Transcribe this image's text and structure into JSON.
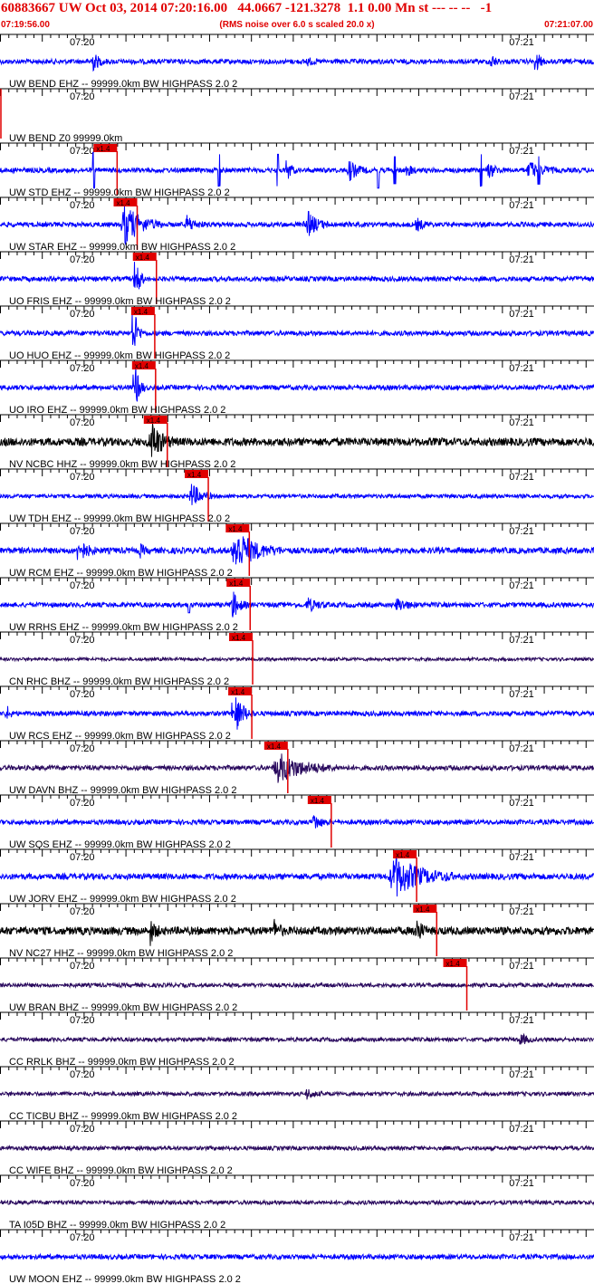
{
  "header": {
    "title": "60883667 UW Oct 03, 2014 07:20:16.00   44.0667 -121.3278  1.1 0.00 Mn st --- -- --   -1",
    "start_time": "07:19:56.00",
    "end_time": "07:21:07.00",
    "rms_note": "(RMS noise over 6.0 s scaled 20.0 x)"
  },
  "colors": {
    "text": "#e00000",
    "pick": "#e00000",
    "trace_blue": "#0000ff",
    "trace_black": "#000000",
    "trace_navy": "#2a0a5e"
  },
  "chart_data": {
    "type": "line",
    "x_range_seconds": [
      0,
      71
    ],
    "time_tick_labels": [
      "07:20",
      "07:21"
    ],
    "pick_label": "x1.4",
    "traces": [
      {
        "label": "UW BEND EHZ -- 99999.0km BW  HIGHPASS  2.0  2",
        "color": "blue",
        "pick_s": null,
        "bursts": [
          [
            10.8,
            2,
            0.5
          ],
          [
            58.6,
            1.2,
            0.35
          ],
          [
            64.1,
            1.2,
            0.4
          ],
          [
            36.5,
            1.5,
            0.2
          ]
        ],
        "spikes": [],
        "noise": 0.12
      },
      {
        "label": "UW BEND Z0 99999.0km",
        "color": "blue",
        "pick_s": null,
        "bursts": [],
        "spikes": [],
        "noise": 0
      },
      {
        "label": "UW STD EHZ -- 99999.0km BW  HIGHPASS  2.0  2",
        "color": "blue",
        "pick_s": 11.4,
        "bursts": [
          [
            34.4,
            1,
            0.5
          ],
          [
            41.5,
            2.5,
            0.5
          ],
          [
            48.7,
            1,
            0.4
          ],
          [
            58.2,
            2,
            0.4
          ],
          [
            62.9,
            4,
            0.4
          ]
        ],
        "spikes": [
          [
            11.2,
            0.9
          ],
          [
            26.2,
            0.8
          ],
          [
            33.2,
            0.8
          ],
          [
            45.2,
            0.9
          ],
          [
            47.2,
            0.7
          ],
          [
            57.5,
            0.8
          ],
          [
            64.4,
            0.7
          ]
        ],
        "noise": 0.12
      },
      {
        "label": "UW STAR EHZ -- 99999.0km BW  HIGHPASS  2.0  2",
        "color": "blue",
        "pick_s": 13.8,
        "bursts": [
          [
            14.4,
            5,
            1.0
          ],
          [
            22.1,
            2.5,
            0.4
          ],
          [
            36.5,
            3,
            0.6
          ],
          [
            49.6,
            2,
            0.3
          ]
        ],
        "spikes": [],
        "noise": 0.12
      },
      {
        "label": "UO FRIS EHZ -- 99999.0km BW  HIGHPASS  2.0  2",
        "color": "blue",
        "pick_s": 16.1,
        "bursts": [
          [
            16.2,
            1.2,
            1.0
          ]
        ],
        "spikes": [],
        "noise": 0.12
      },
      {
        "label": "UO HUO EHZ -- 99999.0km BW  HIGHPASS  2.0  2",
        "color": "blue",
        "pick_s": 15.9,
        "bursts": [
          [
            16.0,
            1.2,
            1.0
          ]
        ],
        "spikes": [],
        "noise": 0.12
      },
      {
        "label": "UO IRO EHZ -- 99999.0km BW  HIGHPASS  2.0  2",
        "color": "blue",
        "pick_s": 16.0,
        "bursts": [
          [
            16.1,
            1.3,
            1.0
          ]
        ],
        "spikes": [],
        "noise": 0.12
      },
      {
        "label": "NV NCBC HHZ -- 99999.0km BW  HIGHPASS  2.0  2",
        "color": "black",
        "pick_s": 17.4,
        "bursts": [
          [
            17.8,
            3,
            1.0
          ]
        ],
        "spikes": [],
        "noise": 0.2
      },
      {
        "label": "UW TDH EHZ -- 99999.0km BW  HIGHPASS  2.0  2",
        "color": "blue",
        "pick_s": 22.3,
        "bursts": [
          [
            22.6,
            3,
            0.6
          ]
        ],
        "spikes": [],
        "noise": 0.1
      },
      {
        "label": "UW RCM EHZ -- 99999.0km BW  HIGHPASS  2.0  2",
        "color": "blue",
        "pick_s": 27.2,
        "bursts": [
          [
            9.1,
            2.5,
            0.6
          ],
          [
            27.6,
            6,
            1.0
          ],
          [
            16.6,
            1.2,
            0.3
          ]
        ],
        "spikes": [],
        "noise": 0.15
      },
      {
        "label": "UW RRHS EHZ -- 99999.0km BW  HIGHPASS  2.0  2",
        "color": "blue",
        "pick_s": 27.3,
        "bursts": [
          [
            27.6,
            2,
            0.7
          ],
          [
            36.5,
            3,
            0.3
          ],
          [
            47.2,
            3,
            0.3
          ]
        ],
        "spikes": [
          [
            22.6,
            0.4
          ]
        ],
        "noise": 0.12
      },
      {
        "label": "CN RHC BHZ -- 99999.0km BW  HIGHPASS  2.0  2",
        "color": "navy",
        "pick_s": 27.6,
        "bursts": [],
        "spikes": [],
        "noise": 0.08
      },
      {
        "label": "UW RCS EHZ -- 99999.0km BW  HIGHPASS  2.0  2",
        "color": "blue",
        "pick_s": 27.5,
        "bursts": [
          [
            27.9,
            2.5,
            1.0
          ],
          [
            0.8,
            1,
            0.3
          ]
        ],
        "spikes": [],
        "noise": 0.12
      },
      {
        "label": "UW DAVN BHZ -- 99999.0km BW  HIGHPASS  2.0  2",
        "color": "navy",
        "pick_s": 31.8,
        "bursts": [
          [
            32.5,
            8,
            0.7
          ]
        ],
        "spikes": [],
        "noise": 0.12
      },
      {
        "label": "UW SQS EHZ -- 99999.0km BW  HIGHPASS  2.0  2",
        "color": "blue",
        "pick_s": 37.0,
        "bursts": [
          [
            37.3,
            2,
            0.4
          ]
        ],
        "spikes": [],
        "noise": 0.12
      },
      {
        "label": "UW JORV EHZ -- 99999.0km BW  HIGHPASS  2.0  2",
        "color": "blue",
        "pick_s": 47.2,
        "bursts": [
          [
            46.4,
            8,
            1.0
          ]
        ],
        "spikes": [],
        "noise": 0.15
      },
      {
        "label": "NV NC27 HHZ -- 99999.0km BW  HIGHPASS  2.0  2",
        "color": "black",
        "pick_s": 49.6,
        "bursts": [
          [
            17.8,
            1.5,
            0.6
          ],
          [
            32.6,
            1.5,
            0.5
          ],
          [
            49.6,
            1.5,
            0.7
          ]
        ],
        "spikes": [],
        "noise": 0.2
      },
      {
        "label": "UW BRAN BHZ -- 99999.0km BW  HIGHPASS  2.0  2",
        "color": "navy",
        "pick_s": 53.2,
        "bursts": [],
        "spikes": [],
        "noise": 0.1
      },
      {
        "label": "CC RRLK BHZ -- 99999.0km BW  HIGHPASS  2.0  2",
        "color": "navy",
        "pick_s": null,
        "bursts": [
          [
            62.0,
            2,
            0.3
          ]
        ],
        "spikes": [],
        "noise": 0.1
      },
      {
        "label": "CC TICBU BHZ -- 99999.0km BW  HIGHPASS  2.0  2",
        "color": "navy",
        "pick_s": null,
        "bursts": [
          [
            36.5,
            2,
            0.25
          ]
        ],
        "spikes": [],
        "noise": 0.1
      },
      {
        "label": "CC WIFE BHZ -- 99999.0km BW  HIGHPASS  2.0  2",
        "color": "navy",
        "pick_s": null,
        "bursts": [],
        "spikes": [],
        "noise": 0.1
      },
      {
        "label": "TA I05D BHZ -- 99999.0km BW  HIGHPASS  2.0  2",
        "color": "navy",
        "pick_s": null,
        "bursts": [],
        "spikes": [],
        "noise": 0.1
      },
      {
        "label": "UW MOON EHZ -- 99999.0km BW  HIGHPASS  2.0  2",
        "color": "blue",
        "pick_s": null,
        "bursts": [],
        "spikes": [],
        "noise": 0.12
      }
    ]
  }
}
